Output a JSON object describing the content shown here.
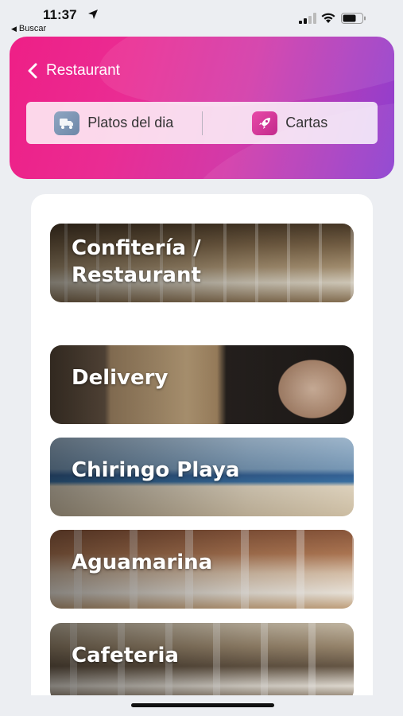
{
  "status_bar": {
    "time": "11:37",
    "back_app": "Buscar",
    "back_app_arrow": "◀"
  },
  "header": {
    "back_label": "Restaurant",
    "tabs": [
      {
        "label": "Platos del dia",
        "icon": "plate-service-icon"
      },
      {
        "label": "Cartas",
        "icon": "rocket-icon"
      }
    ]
  },
  "categories": [
    {
      "label_line1": "Confitería /",
      "label_line2": "Restaurant"
    },
    {
      "label_line1": "Delivery"
    },
    {
      "label_line1": "Chiringo Playa"
    },
    {
      "label_line1": "Aguamarina"
    },
    {
      "label_line1": "Cafeteria"
    }
  ],
  "colors": {
    "header_gradient_start": "#ee1f86",
    "header_gradient_end": "#8c3fd0",
    "background": "#eceef2"
  }
}
